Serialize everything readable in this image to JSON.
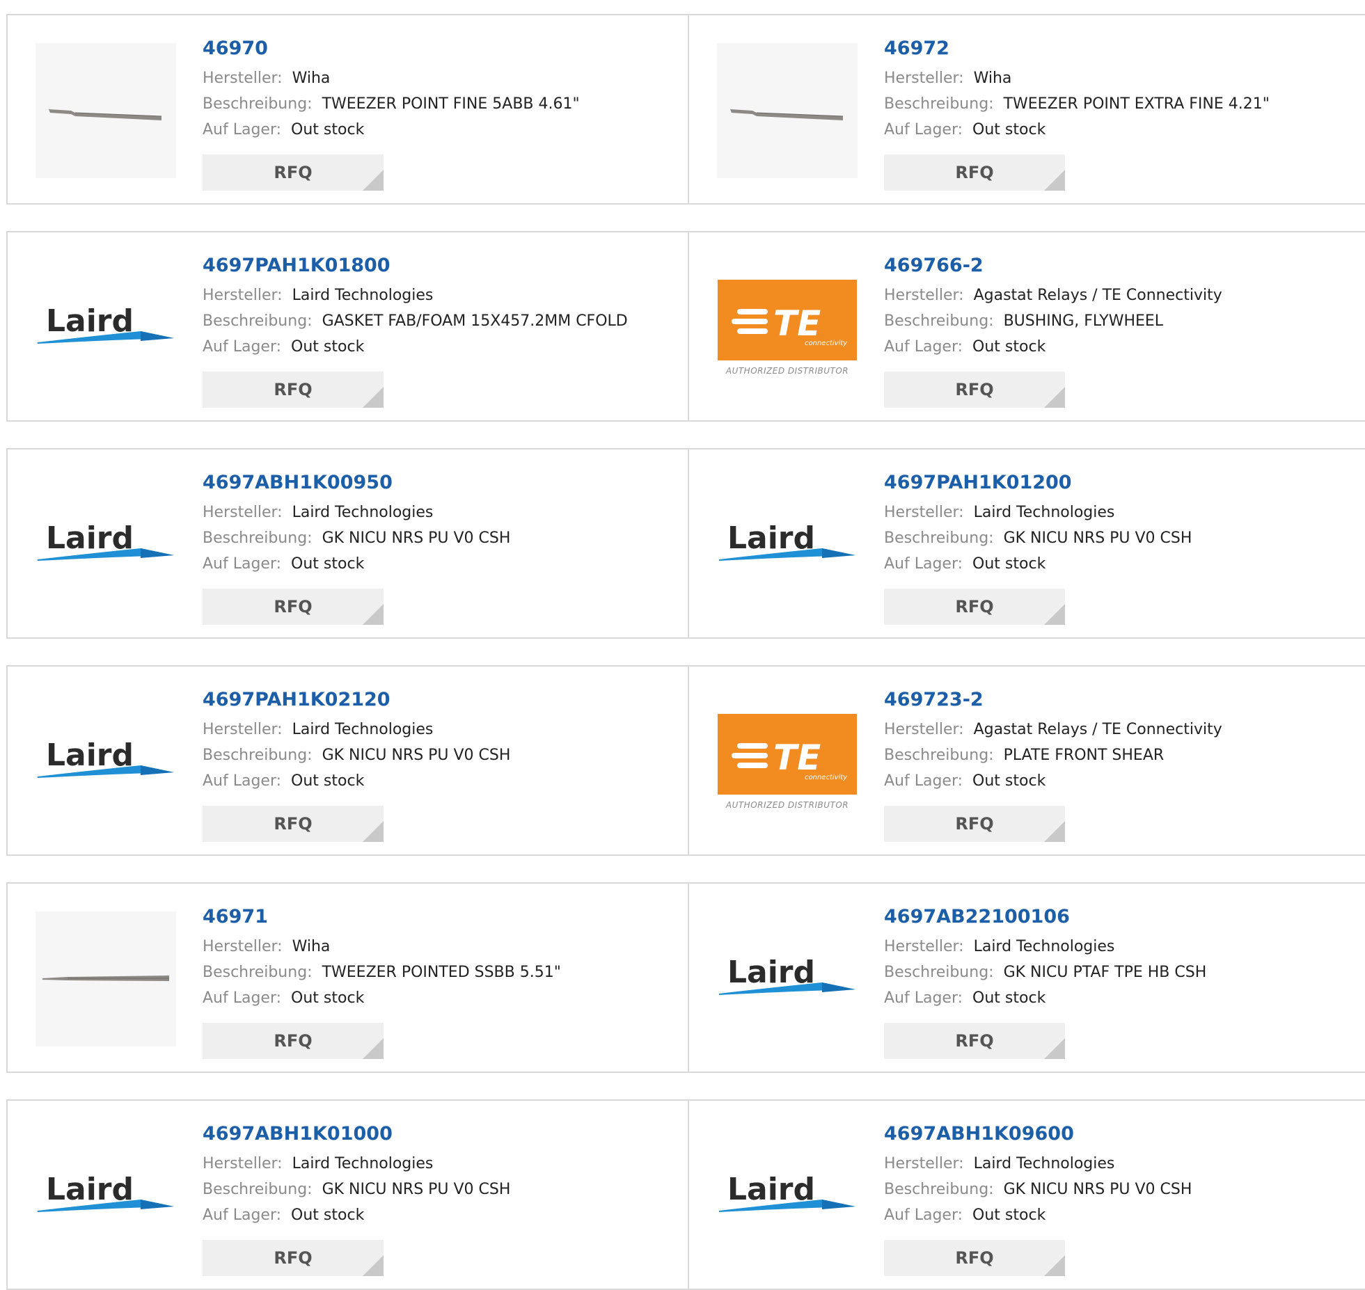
{
  "labels": {
    "manufacturer": "Hersteller:",
    "description": "Beschreibung:",
    "stock": "Auf Lager:",
    "rfq": "RFQ"
  },
  "logos": {
    "laird": {
      "text": "Laird",
      "text_color": "#2b2b2b",
      "swoosh_color": "#1f8fd6"
    },
    "te": {
      "text": "TE",
      "sub": "connectivity",
      "caption": "AUTHORIZED DISTRIBUTOR",
      "bg_color": "#f28b20"
    }
  },
  "products": [
    {
      "part": "46970",
      "manufacturer": "Wiha",
      "description": "TWEEZER POINT FINE 5ABB 4.61\"",
      "stock": "Out stock",
      "image": "tweezer-bent"
    },
    {
      "part": "46972",
      "manufacturer": "Wiha",
      "description": "TWEEZER POINT EXTRA FINE 4.21\"",
      "stock": "Out stock",
      "image": "tweezer-bent"
    },
    {
      "part": "4697PAH1K01800",
      "manufacturer": "Laird Technologies",
      "description": "GASKET FAB/FOAM 15X457.2MM CFOLD",
      "stock": "Out stock",
      "image": "laird-logo"
    },
    {
      "part": "469766-2",
      "manufacturer": "Agastat Relays / TE Connectivity",
      "description": "BUSHING, FLYWHEEL",
      "stock": "Out stock",
      "image": "te-logo"
    },
    {
      "part": "4697ABH1K00950",
      "manufacturer": "Laird Technologies",
      "description": "GK NICU NRS PU V0 CSH",
      "stock": "Out stock",
      "image": "laird-logo"
    },
    {
      "part": "4697PAH1K01200",
      "manufacturer": "Laird Technologies",
      "description": "GK NICU NRS PU V0 CSH",
      "stock": "Out stock",
      "image": "laird-logo"
    },
    {
      "part": "4697PAH1K02120",
      "manufacturer": "Laird Technologies",
      "description": "GK NICU NRS PU V0 CSH",
      "stock": "Out stock",
      "image": "laird-logo"
    },
    {
      "part": "469723-2",
      "manufacturer": "Agastat Relays / TE Connectivity",
      "description": "PLATE FRONT SHEAR",
      "stock": "Out stock",
      "image": "te-logo"
    },
    {
      "part": "46971",
      "manufacturer": "Wiha",
      "description": "TWEEZER POINTED SSBB 5.51\"",
      "stock": "Out stock",
      "image": "tweezer-straight"
    },
    {
      "part": "4697AB22100106",
      "manufacturer": "Laird Technologies",
      "description": "GK NICU PTAF TPE HB CSH",
      "stock": "Out stock",
      "image": "laird-logo"
    },
    {
      "part": "4697ABH1K01000",
      "manufacturer": "Laird Technologies",
      "description": "GK NICU NRS PU V0 CSH",
      "stock": "Out stock",
      "image": "laird-logo"
    },
    {
      "part": "4697ABH1K09600",
      "manufacturer": "Laird Technologies",
      "description": "GK NICU NRS PU V0 CSH",
      "stock": "Out stock",
      "image": "laird-logo"
    }
  ]
}
